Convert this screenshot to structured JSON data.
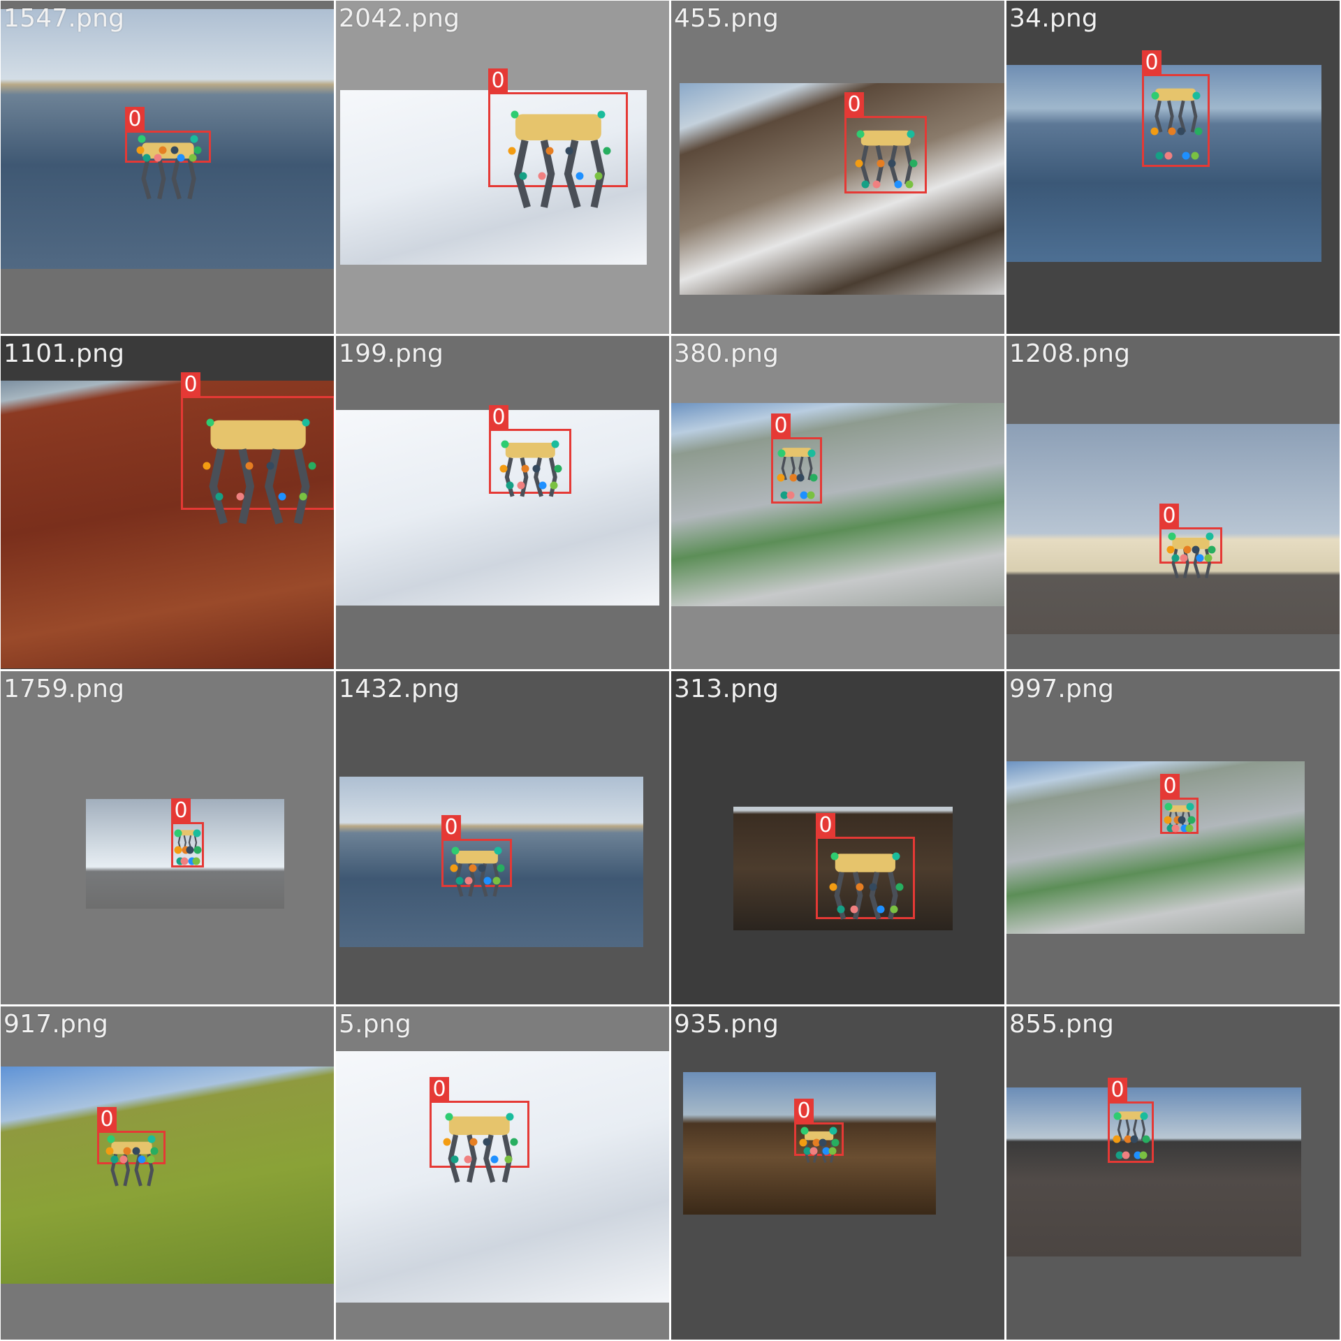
{
  "grid_title": "",
  "class_label": "0",
  "colors": {
    "bbox": "#e53935",
    "robot_body": "#e6c46c",
    "robot_leg": "#4a4f57",
    "keypoints": [
      "#2ecc71",
      "#1abc9c",
      "#f39c12",
      "#e67e22",
      "#34495e",
      "#27ae60",
      "#16a085",
      "#f08080",
      "#1e90ff",
      "#7ac142"
    ]
  },
  "tiles": [
    {
      "filename": "1547.png",
      "frame_bg": "#6f6f6f",
      "scene": "water"
    },
    {
      "filename": "2042.png",
      "frame_bg": "#9a9a9a",
      "scene": "white-platform"
    },
    {
      "filename": "455.png",
      "frame_bg": "#777777",
      "scene": "rocky"
    },
    {
      "filename": "34.png",
      "frame_bg": "#444444",
      "scene": "water-dark"
    },
    {
      "filename": "1101.png",
      "frame_bg": "#3a3a3a",
      "scene": "red-ground"
    },
    {
      "filename": "199.png",
      "frame_bg": "#6e6e6e",
      "scene": "white-platform"
    },
    {
      "filename": "380.png",
      "frame_bg": "#8a8a8a",
      "scene": "mossy"
    },
    {
      "filename": "1208.png",
      "frame_bg": "#666666",
      "scene": "sand"
    },
    {
      "filename": "1759.png",
      "frame_bg": "#7a7a7a",
      "scene": "sky-small"
    },
    {
      "filename": "1432.png",
      "frame_bg": "#555555",
      "scene": "water"
    },
    {
      "filename": "313.png",
      "frame_bg": "#3c3c3c",
      "scene": "dark-ground"
    },
    {
      "filename": "997.png",
      "frame_bg": "#6a6a6a",
      "scene": "mossy"
    },
    {
      "filename": "917.png",
      "frame_bg": "#777777",
      "scene": "grass"
    },
    {
      "filename": "5.png",
      "frame_bg": "#7d7d7d",
      "scene": "white-platform"
    },
    {
      "filename": "935.png",
      "frame_bg": "#4c4c4c",
      "scene": "brown-ground"
    },
    {
      "filename": "855.png",
      "frame_bg": "#5a5a5a",
      "scene": "dark-flat"
    }
  ]
}
